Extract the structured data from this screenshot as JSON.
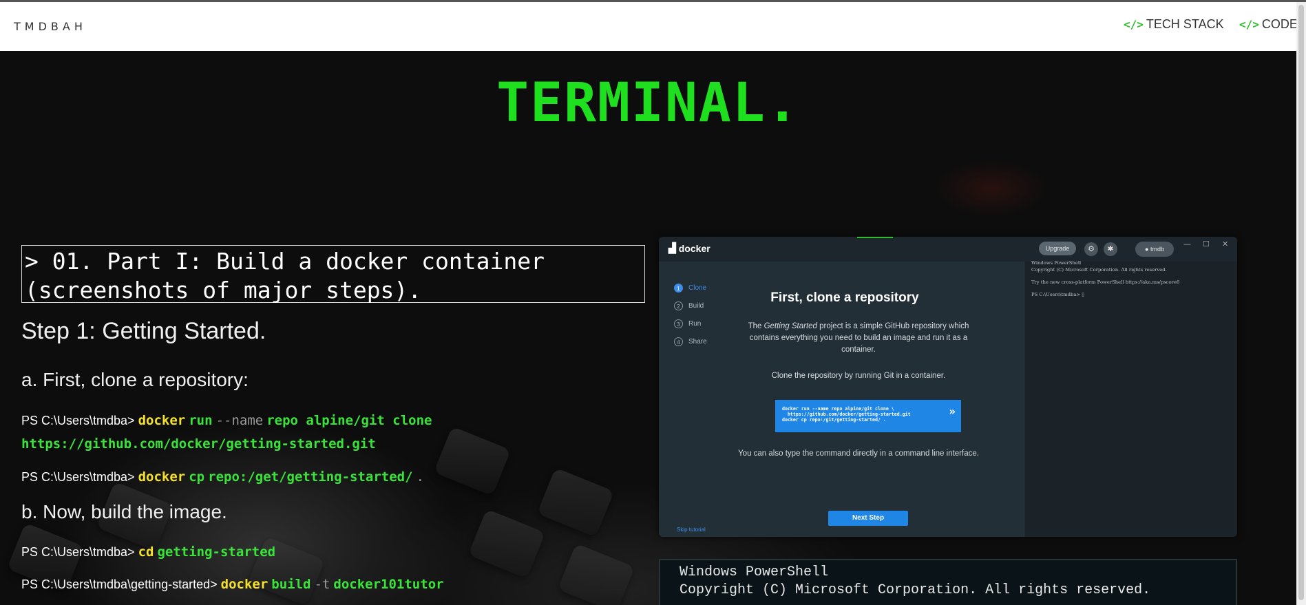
{
  "nav": {
    "brand": "TMDBAH",
    "links": [
      {
        "icon": "code-icon",
        "icon_glyph": "</>",
        "label": "TECH STACK"
      },
      {
        "icon": "code-icon",
        "icon_glyph": "</>",
        "label": "CODE"
      }
    ]
  },
  "hero": {
    "title": "TERMINAL."
  },
  "content": {
    "section_heading": "> 01. Part I: Build a docker container (screenshots of major steps).",
    "step_heading": "Step 1: Getting Started.",
    "sub_a": "a. First, clone a repository:",
    "sub_b": "b. Now, build the image.",
    "commands": {
      "c1": {
        "prompt": "PS C:\\Users\\tmdba>",
        "w1": "docker",
        "w2": "run",
        "w3": "--name",
        "w4": "repo alpine/git clone",
        "w5": "https://github.com/docker/getting-started.git"
      },
      "c2": {
        "prompt": "PS C:\\Users\\tmdba>",
        "w1": "docker",
        "w2": "cp",
        "w3": "repo:/get/getting-started/",
        "w4": "."
      },
      "c3": {
        "prompt": "PS C:\\Users\\tmdba>",
        "w1": "cd",
        "w2": "getting-started"
      },
      "c4": {
        "prompt": "PS C:\\Users\\tmdba\\getting-started>",
        "w1": "docker",
        "w2": "build",
        "w3": "-t",
        "w4": "docker101tutor"
      }
    }
  },
  "docker_screenshot": {
    "logo": "docker",
    "upgrade": "Upgrade",
    "user": "tmdb",
    "steps": [
      {
        "num": "1",
        "label": "Clone"
      },
      {
        "num": "2",
        "label": "Build"
      },
      {
        "num": "3",
        "label": "Run"
      },
      {
        "num": "4",
        "label": "Share"
      }
    ],
    "heading": "First, clone a repository",
    "para_pre": "The ",
    "para_em": "Getting Started",
    "para_post": " project is a simple GitHub repository which contains everything you need to build an image and run it as a container.",
    "clone_hint": "Clone the repository by running Git in a container.",
    "cmd_lines": [
      "docker run --name repo alpine/git clone \\",
      "  https://github.com/docker/getting-started.git",
      "docker cp repo:/git/getting-started/ ."
    ],
    "also_text": "You can also type the command directly in a command line interface.",
    "next_button": "Next Step",
    "skip": "Skip tutorial",
    "terminal_lines": [
      "Windows PowerShell",
      "Copyright (C) Microsoft Corporation. All rights reserved.",
      "Try the new cross-platform PowerShell https://aka.ms/pscore6",
      "PS C:\\Users\\tmdba> ▯"
    ]
  },
  "powershell_screenshot": {
    "line1": "Windows PowerShell",
    "line2": "Copyright (C) Microsoft Corporation. All rights reserved."
  },
  "colors": {
    "accent_green": "#1ee01e",
    "keyword_yellow": "#f5e12a",
    "docker_blue": "#1f86e6"
  }
}
